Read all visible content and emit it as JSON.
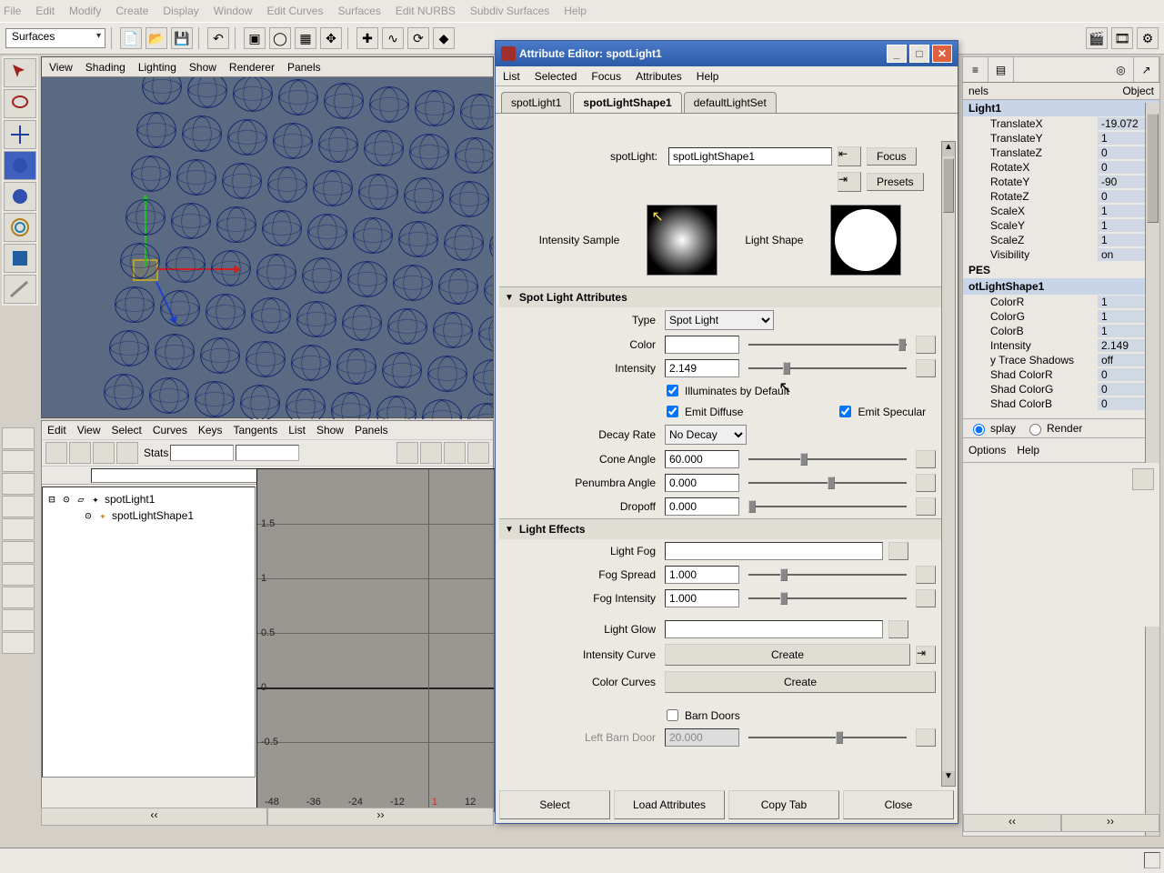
{
  "main_menu": [
    "File",
    "Edit",
    "Modify",
    "Create",
    "Display",
    "Window",
    "Edit Curves",
    "Surfaces",
    "Edit NURBS",
    "Subdiv Surfaces",
    "Help"
  ],
  "toolbar": {
    "mode": "Surfaces"
  },
  "viewport_menu": [
    "View",
    "Shading",
    "Lighting",
    "Show",
    "Renderer",
    "Panels"
  ],
  "lower_menu": [
    "Edit",
    "View",
    "Select",
    "Curves",
    "Keys",
    "Tangents",
    "List",
    "Show",
    "Panels"
  ],
  "lower": {
    "stats_label": "Stats"
  },
  "outliner": {
    "item1": "spotLight1",
    "item2": "spotLightShape1"
  },
  "graph": {
    "y_ticks": [
      "1.5",
      "1",
      "0.5",
      "0",
      "-0.5"
    ],
    "x_ticks": [
      "-48",
      "-36",
      "-24",
      "-12",
      "1",
      "12"
    ]
  },
  "ae": {
    "title": "Attribute Editor: spotLight1",
    "menu": [
      "List",
      "Selected",
      "Focus",
      "Attributes",
      "Help"
    ],
    "tabs": [
      "spotLight1",
      "spotLightShape1",
      "defaultLightSet"
    ],
    "active_tab": 1,
    "node_label": "spotLight:",
    "node_name": "spotLightShape1",
    "focus": "Focus",
    "presets": "Presets",
    "intensity_sample": "Intensity Sample",
    "light_shape": "Light Shape",
    "sections": {
      "spot": "Spot Light Attributes",
      "effects": "Light Effects"
    },
    "attrs": {
      "type_label": "Type",
      "type_value": "Spot Light",
      "color_label": "Color",
      "intensity_label": "Intensity",
      "intensity_value": "2.149",
      "illum_default": "Illuminates by Default",
      "emit_diffuse": "Emit Diffuse",
      "emit_specular": "Emit Specular",
      "decay_label": "Decay Rate",
      "decay_value": "No Decay",
      "cone_label": "Cone Angle",
      "cone_value": "60.000",
      "penumbra_label": "Penumbra Angle",
      "penumbra_value": "0.000",
      "dropoff_label": "Dropoff",
      "dropoff_value": "0.000",
      "light_fog": "Light Fog",
      "fog_spread_label": "Fog Spread",
      "fog_spread_value": "1.000",
      "fog_intensity_label": "Fog Intensity",
      "fog_intensity_value": "1.000",
      "light_glow": "Light Glow",
      "intensity_curve": "Intensity Curve",
      "color_curves": "Color Curves",
      "create": "Create",
      "barn_doors": "Barn Doors",
      "left_barn_label": "Left Barn Door",
      "left_barn_value": "20.000"
    },
    "footer": [
      "Select",
      "Load Attributes",
      "Copy Tab",
      "Close"
    ]
  },
  "channel": {
    "tabs": {
      "channels": "nels",
      "object": "Object"
    },
    "node": "Light1",
    "shapes": "PES",
    "shape_name": "otLightShape1",
    "xforms": [
      {
        "l": "TranslateX",
        "v": "-19.072"
      },
      {
        "l": "TranslateY",
        "v": "1"
      },
      {
        "l": "TranslateZ",
        "v": "0"
      },
      {
        "l": "RotateX",
        "v": "0"
      },
      {
        "l": "RotateY",
        "v": "-90"
      },
      {
        "l": "RotateZ",
        "v": "0"
      },
      {
        "l": "ScaleX",
        "v": "1"
      },
      {
        "l": "ScaleY",
        "v": "1"
      },
      {
        "l": "ScaleZ",
        "v": "1"
      },
      {
        "l": "Visibility",
        "v": "on"
      }
    ],
    "shape_attrs": [
      {
        "l": "ColorR",
        "v": "1"
      },
      {
        "l": "ColorG",
        "v": "1"
      },
      {
        "l": "ColorB",
        "v": "1"
      },
      {
        "l": "Intensity",
        "v": "2.149"
      },
      {
        "l": "y Trace Shadows",
        "v": "off"
      },
      {
        "l": "Shad ColorR",
        "v": "0"
      },
      {
        "l": "Shad ColorG",
        "v": "0"
      },
      {
        "l": "Shad ColorB",
        "v": "0"
      }
    ],
    "display": "splay",
    "render": "Render",
    "options": "Options",
    "help": "Help"
  }
}
